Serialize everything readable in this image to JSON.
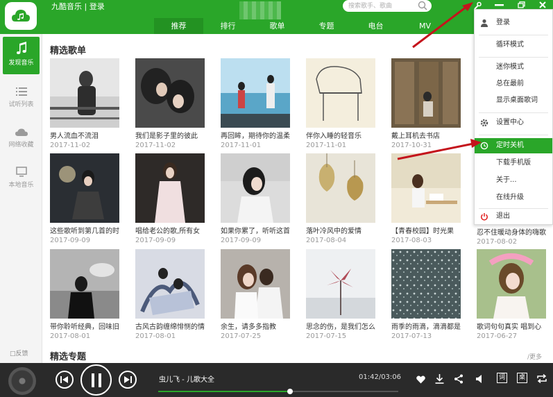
{
  "header": {
    "app_title": "九酷音乐 | 登录",
    "search_placeholder": "搜索歌手、歌曲",
    "tabs": [
      "推荐",
      "排行",
      "歌单",
      "专题",
      "电台",
      "MV"
    ],
    "active_tab": "推荐",
    "accent_color": "#2aa629"
  },
  "sidebar": {
    "items": [
      {
        "label": "发现音乐",
        "icon": "music-note-icon",
        "active": true
      },
      {
        "label": "试听列表",
        "icon": "list-icon",
        "active": false
      },
      {
        "label": "网络收藏",
        "icon": "cloud-icon",
        "active": false
      },
      {
        "label": "本地音乐",
        "icon": "monitor-icon",
        "active": false
      }
    ],
    "feedback_label": "反馈"
  },
  "main": {
    "section_title": "精选歌单",
    "section2_title": "精选专题",
    "more_label": "/更多",
    "cards": [
      {
        "title": "男人流血不流泪",
        "date": "2017-11-02"
      },
      {
        "title": "我们是影子里的彼此",
        "date": "2017-11-02"
      },
      {
        "title": "再回眸，期待你的温柔",
        "date": "2017-11-01"
      },
      {
        "title": "伴你入睡的轻音乐",
        "date": "2017-11-01"
      },
      {
        "title": "戴上耳机去书店",
        "date": "2017-10-31"
      },
      {
        "title": "这些歌听到第几首的时",
        "date": "2017-09-09"
      },
      {
        "title": "唱给老公的歌,所有女",
        "date": "2017-09-09"
      },
      {
        "title": "如果你累了，听听这首",
        "date": "2017-09-09"
      },
      {
        "title": "落叶冷风中的爱情",
        "date": "2017-08-04"
      },
      {
        "title": "【青春校园】时光果",
        "date": "2017-08-03"
      },
      {
        "title": "忍不住暖动身体的嗨歌",
        "date": "2017-08-02"
      },
      {
        "title": "带你聆听经典，回味旧",
        "date": "2017-08-01"
      },
      {
        "title": "古风古韵缠绵悱恻的情",
        "date": "2017-08-01"
      },
      {
        "title": "余生，请多多指教",
        "date": "2017-07-25"
      },
      {
        "title": "思念的伤，是我们怎么",
        "date": "2017-07-15"
      },
      {
        "title": "雨季的雨滴，滴滴都是",
        "date": "2017-07-13"
      },
      {
        "title": "歌词句句真实 唱到心",
        "date": "2017-06-27"
      }
    ]
  },
  "menu": {
    "items": [
      {
        "label": "登录",
        "icon": "user-icon"
      },
      {
        "label": "循环模式",
        "icon": ""
      },
      {
        "label": "迷你模式",
        "icon": ""
      },
      {
        "label": "总在最前",
        "icon": ""
      },
      {
        "label": "显示桌面歌词",
        "icon": ""
      },
      {
        "label": "设置中心",
        "icon": "gear-icon"
      },
      {
        "label": "定时关机",
        "icon": "clock-icon",
        "highlighted": true
      },
      {
        "label": "下载手机版",
        "icon": ""
      },
      {
        "label": "关于...",
        "icon": ""
      },
      {
        "label": "在线升级",
        "icon": ""
      },
      {
        "label": "退出",
        "icon": "power-icon"
      }
    ]
  },
  "player": {
    "song": "虫儿飞 - 儿歌大全",
    "time": "01:42/03:06",
    "progress": 0.548,
    "lyric_btn": "词",
    "desk_btn": "桌"
  }
}
